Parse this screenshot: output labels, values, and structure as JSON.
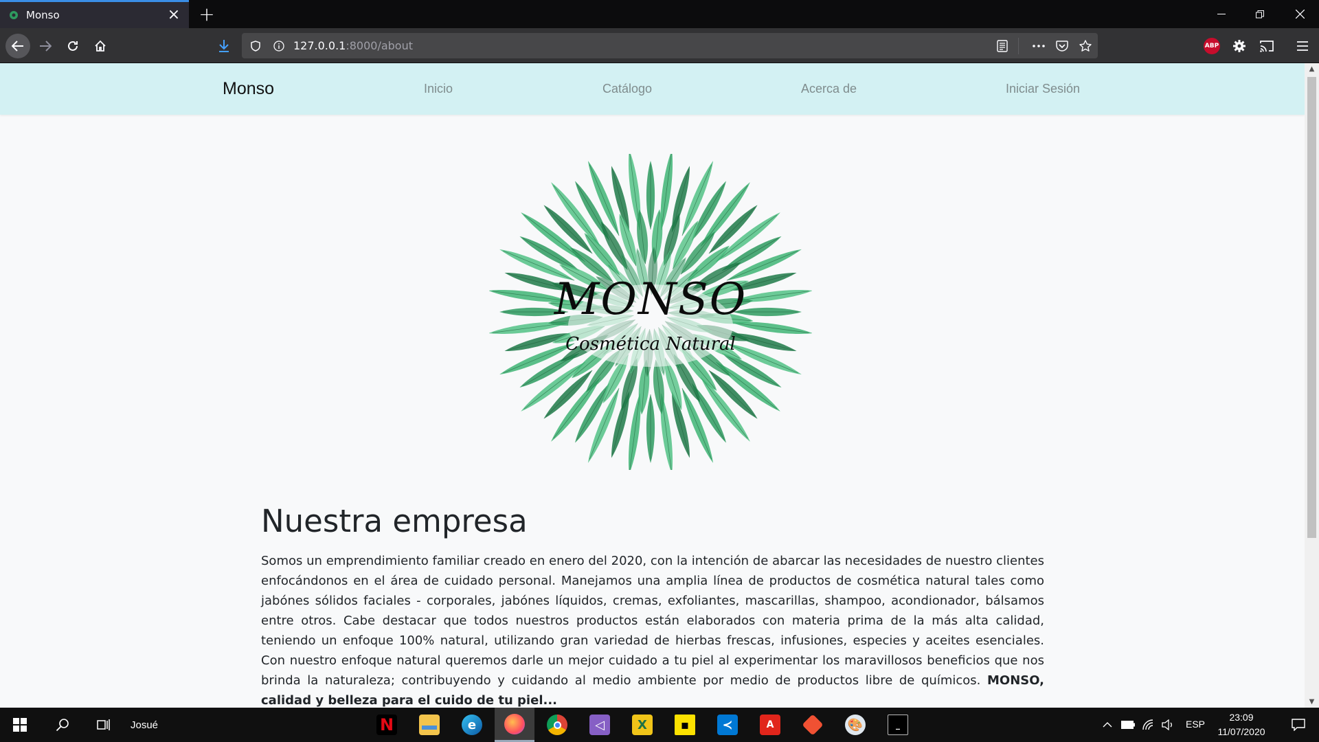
{
  "browser": {
    "tab_title": "Monso",
    "url_host": "127.0.0.1",
    "url_path": ":8000/about"
  },
  "site": {
    "brand": "Monso",
    "nav": [
      "Inicio",
      "Catálogo",
      "Acerca de",
      "Iniciar Sesión"
    ]
  },
  "logo": {
    "title": "MONSO",
    "subtitle": "Cosmética Natural",
    "leaf_color": "#2e9b5f"
  },
  "about": {
    "heading": "Nuestra empresa",
    "body": "Somos un emprendimiento familiar creado en enero del 2020, con la intención de abarcar las necesidades de nuestro clientes enfocándonos en el área de cuidado personal. Manejamos una amplia línea de productos de cosmética natural tales como jabónes sólidos faciales - corporales, jabónes líquidos, cremas, exfoliantes, mascarillas, shampoo, acondionador, bálsamos entre otros. Cabe destacar que todos nuestros productos están elaborados con materia prima de la más alta calidad, teniendo un enfoque 100% natural, utilizando gran variedad de hierbas frescas, infusiones, especies y aceites esenciales. Con nuestro enfoque natural queremos darle un mejor cuidado a tu piel al experimentar los maravillosos beneficios que nos brinda la naturaleza; contribuyendo y cuidando al medio ambiente por medio de productos libre de químicos.",
    "tagline": "MONSO, calidad y belleza para el cuido de tu piel..."
  },
  "taskbar": {
    "user": "Josué",
    "language": "ESP",
    "time": "23:09",
    "date": "11/07/2020",
    "apps": [
      "netflix",
      "file-explorer",
      "edge",
      "firefox",
      "chrome",
      "visual-studio",
      "excel",
      "sticky-notes",
      "vscode",
      "acrobat",
      "git-kraken",
      "paint",
      "terminal"
    ]
  }
}
